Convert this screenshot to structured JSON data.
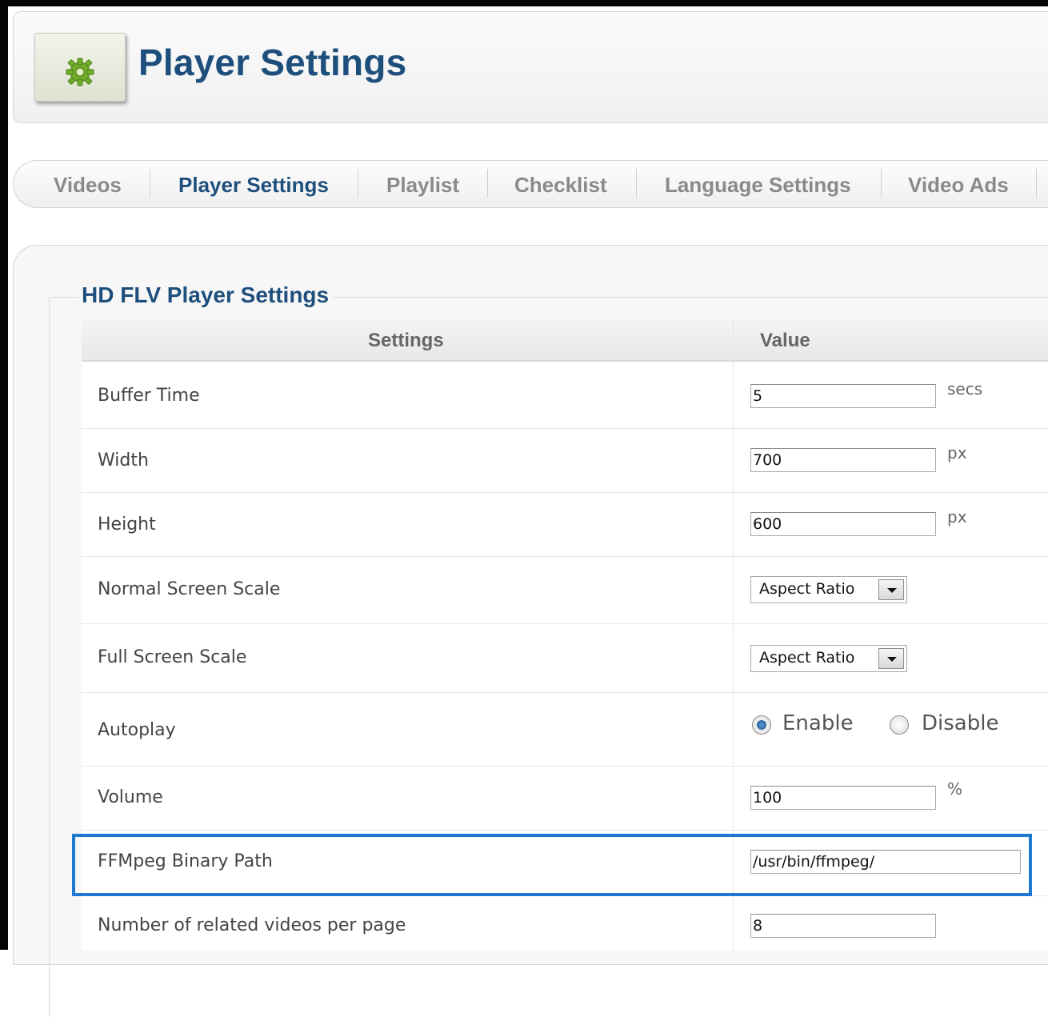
{
  "header": {
    "title": "Player Settings",
    "icon": "gear-icon"
  },
  "tabs": [
    {
      "label": "Videos",
      "active": false
    },
    {
      "label": "Player Settings",
      "active": true
    },
    {
      "label": "Playlist",
      "active": false
    },
    {
      "label": "Checklist",
      "active": false
    },
    {
      "label": "Language Settings",
      "active": false
    },
    {
      "label": "Video Ads",
      "active": false
    }
  ],
  "section": {
    "legend": "HD FLV Player Settings"
  },
  "table": {
    "headers": {
      "settings": "Settings",
      "value": "Value"
    },
    "rows": {
      "buffer_time": {
        "label": "Buffer Time",
        "value": "5",
        "unit": "secs"
      },
      "width": {
        "label": "Width",
        "value": "700",
        "unit": "px"
      },
      "height": {
        "label": "Height",
        "value": "600",
        "unit": "px"
      },
      "normal_scale": {
        "label": "Normal Screen Scale",
        "selected": "Aspect Ratio"
      },
      "full_scale": {
        "label": "Full Screen Scale",
        "selected": "Aspect Ratio"
      },
      "autoplay": {
        "label": "Autoplay",
        "option_enable": "Enable",
        "option_disable": "Disable",
        "selected": "Enable"
      },
      "volume": {
        "label": "Volume",
        "value": "100",
        "unit": "%"
      },
      "ffmpeg_path": {
        "label": "FFMpeg Binary Path",
        "value": "/usr/bin/ffmpeg/"
      },
      "related_videos": {
        "label": "Number of related videos per page",
        "value": "8"
      }
    }
  },
  "colors": {
    "title": "#1e4f7c",
    "highlight_border": "#1f78d1"
  }
}
